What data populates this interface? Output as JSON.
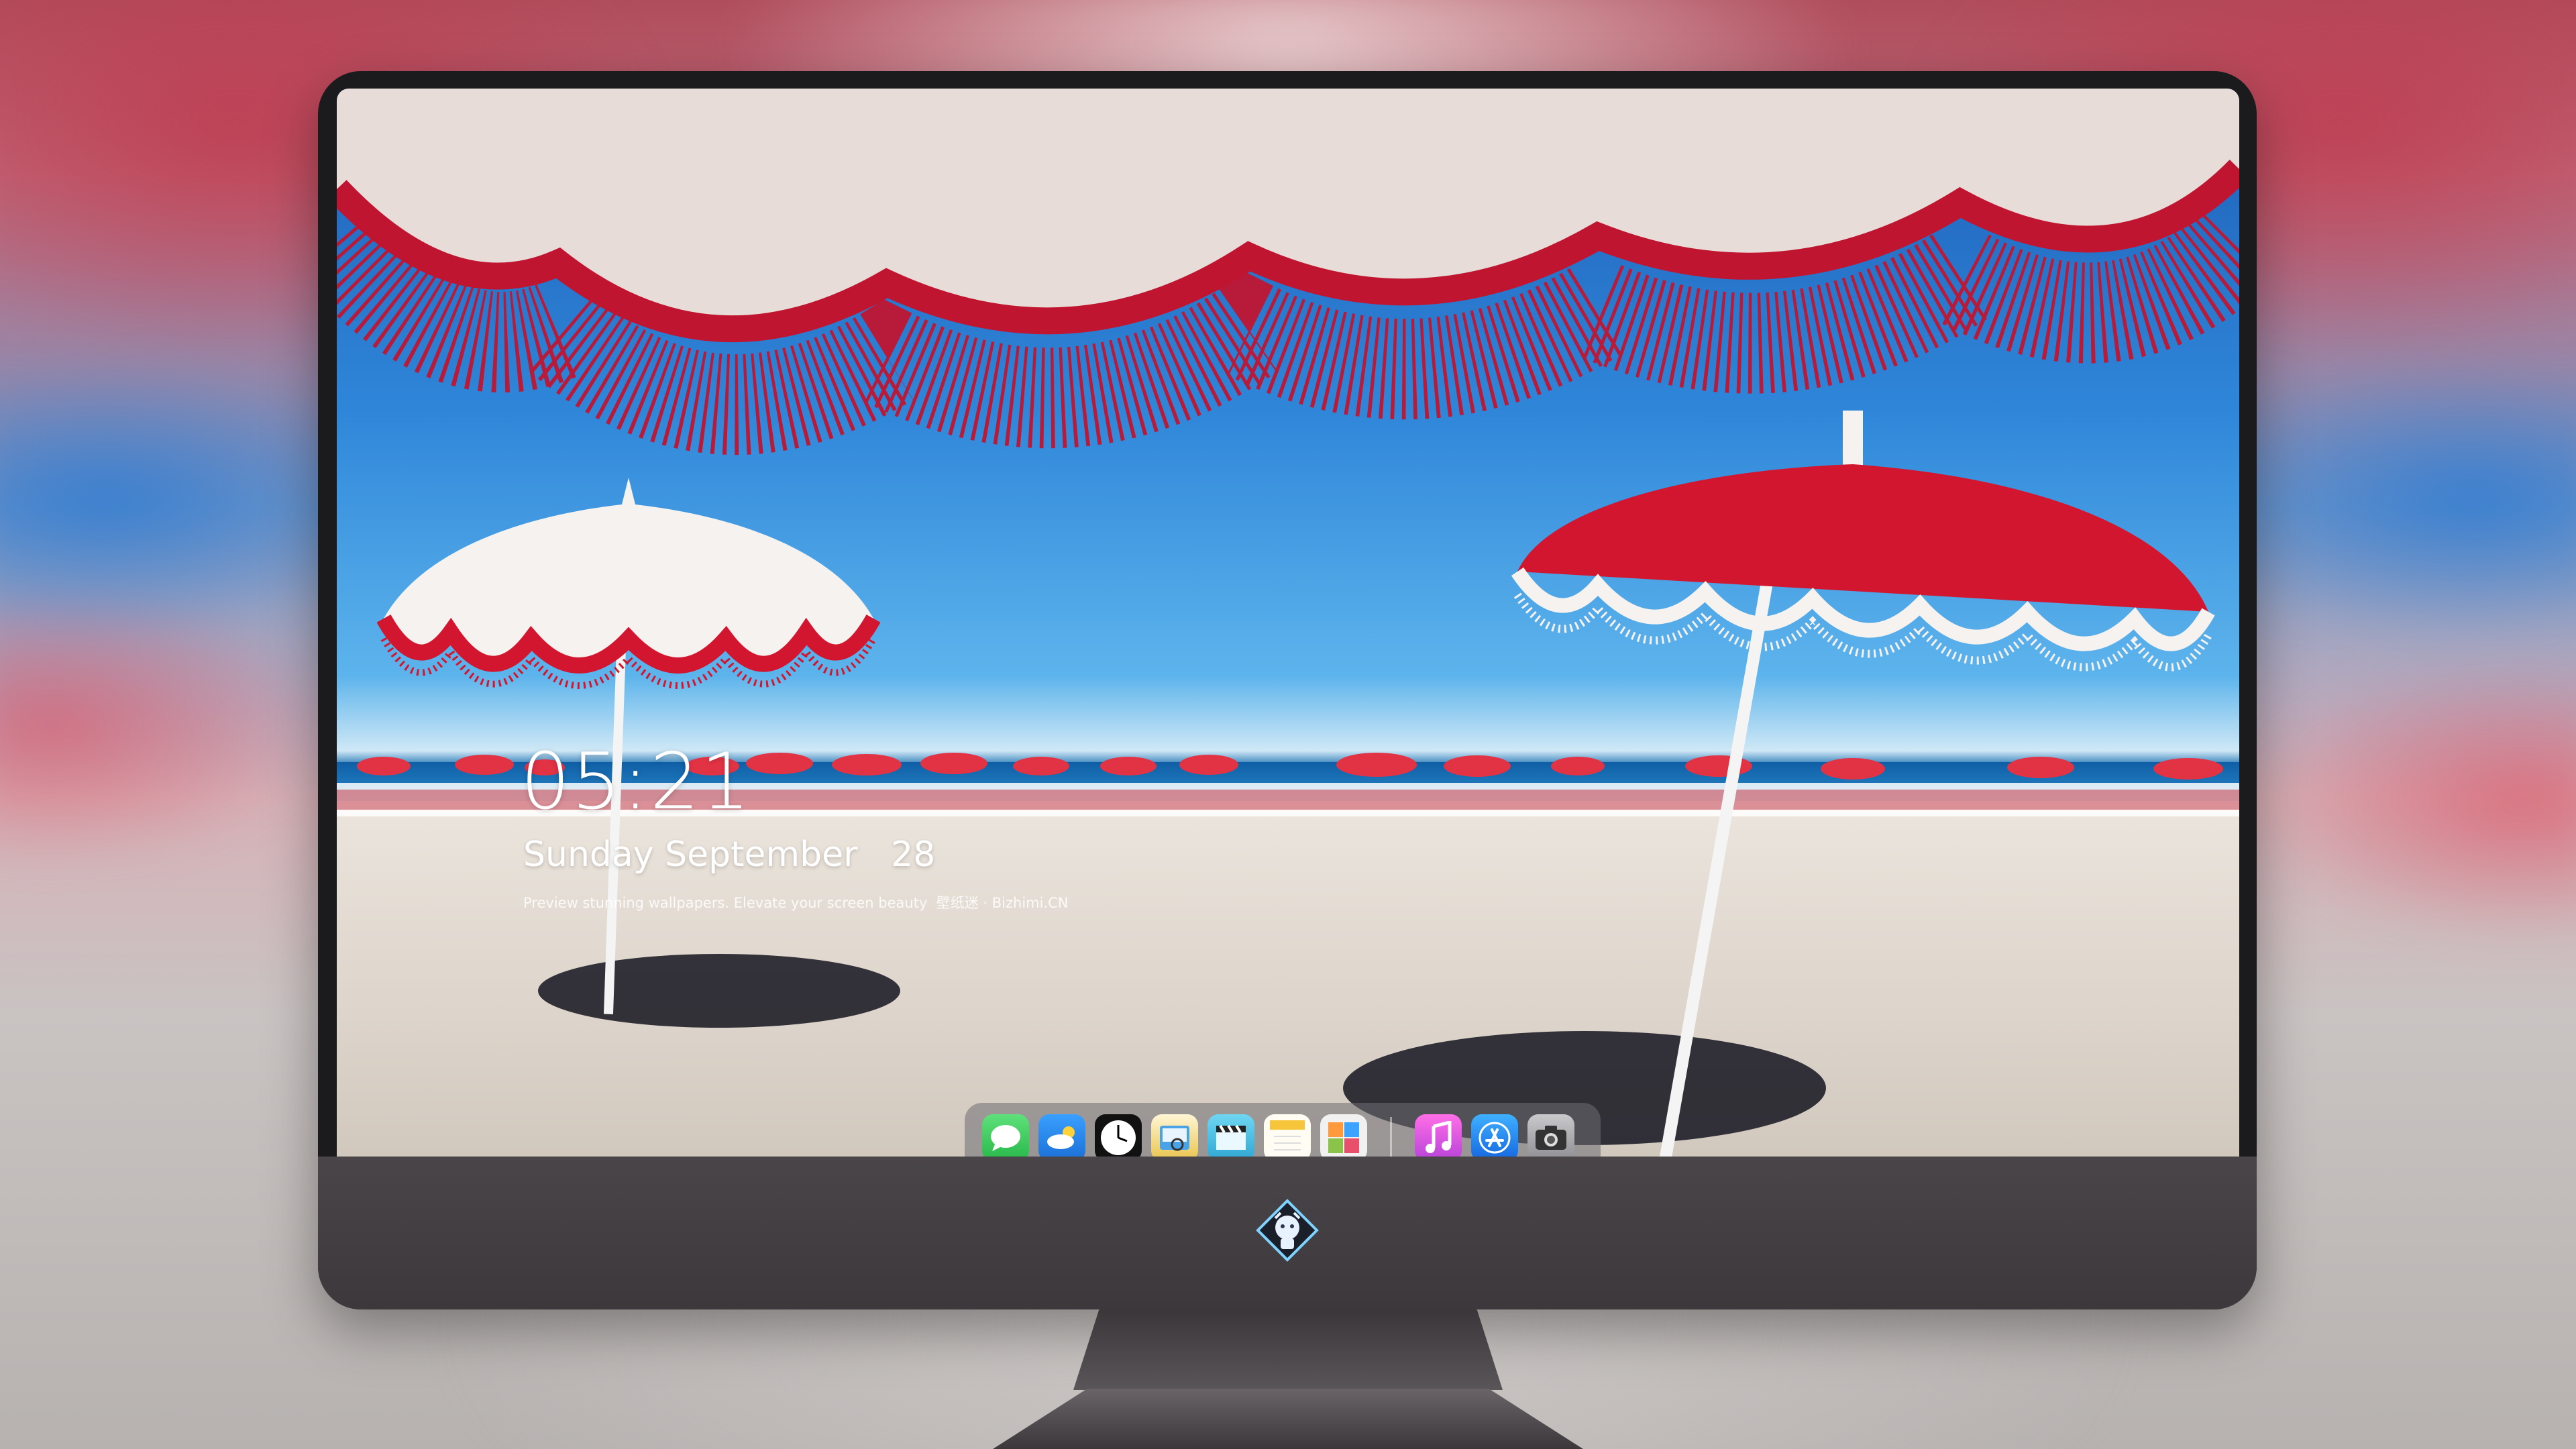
{
  "lockscreen": {
    "time": "05:21",
    "date": "Sunday September   28",
    "tagline": "Preview stunning wallpapers. Elevate your screen beauty  壁纸迷 · Bizhimi.CN"
  },
  "dock": {
    "apps": [
      {
        "name": "messages",
        "icon": "chat-bubble-icon",
        "color": "#34c759"
      },
      {
        "name": "weather",
        "icon": "cloud-icon",
        "color": "#2a8ef0"
      },
      {
        "name": "clock",
        "icon": "clock-icon",
        "color": "#ffffff"
      },
      {
        "name": "preview",
        "icon": "image-viewer-icon",
        "color": "#e9c34a"
      },
      {
        "name": "clips",
        "icon": "clapperboard-icon",
        "color": "#4ac3e6"
      },
      {
        "name": "notes",
        "icon": "notes-icon",
        "color": "#f7d34a"
      },
      {
        "name": "photos-grid",
        "icon": "photo-grid-icon",
        "color": "#8bc34a"
      },
      {
        "name": "music",
        "icon": "music-note-icon",
        "color": "#e84fd6"
      },
      {
        "name": "app-store",
        "icon": "app-store-icon",
        "color": "#1e90ff"
      },
      {
        "name": "camera",
        "icon": "camera-icon",
        "color": "#5b5b5f"
      }
    ]
  },
  "colors": {
    "umbrella_red": "#d2162f",
    "sky_blue": "#2f86d9",
    "monitor_frame": "#1b1b1e"
  }
}
